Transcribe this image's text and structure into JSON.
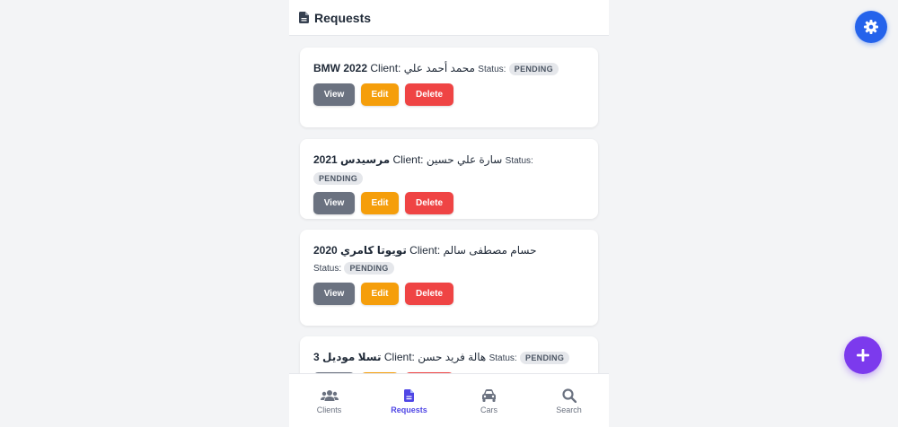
{
  "header": {
    "title": "Requests",
    "icon": "file-icon"
  },
  "labels": {
    "client": "Client:",
    "status": "Status:",
    "view": "View",
    "edit": "Edit",
    "delete": "Delete"
  },
  "requests": [
    {
      "car": "BMW 2022",
      "client": "محمد أحمد علي",
      "status": "PENDING"
    },
    {
      "car": "مرسيدس 2021",
      "client": "سارة علي حسين",
      "status": "PENDING"
    },
    {
      "car": "تويوتا كامري 2020",
      "client": "حسام مصطفى سالم",
      "status": "PENDING"
    },
    {
      "car": "تسلا موديل 3",
      "client": "هالة فريد حسن",
      "status": "PENDING"
    }
  ],
  "nav": [
    {
      "label": "Clients",
      "icon": "users-icon",
      "active": false
    },
    {
      "label": "Requests",
      "icon": "file-icon",
      "active": true
    },
    {
      "label": "Cars",
      "icon": "car-icon",
      "active": false
    },
    {
      "label": "Search",
      "icon": "search-icon",
      "active": false
    }
  ],
  "colors": {
    "accent": "#4f46e5",
    "settings_fab": "#2563eb",
    "add_fab": "#7c3aed",
    "view": "#6b7280",
    "edit": "#f59e0b",
    "delete": "#ef4444",
    "badge": "#e5e7eb"
  }
}
